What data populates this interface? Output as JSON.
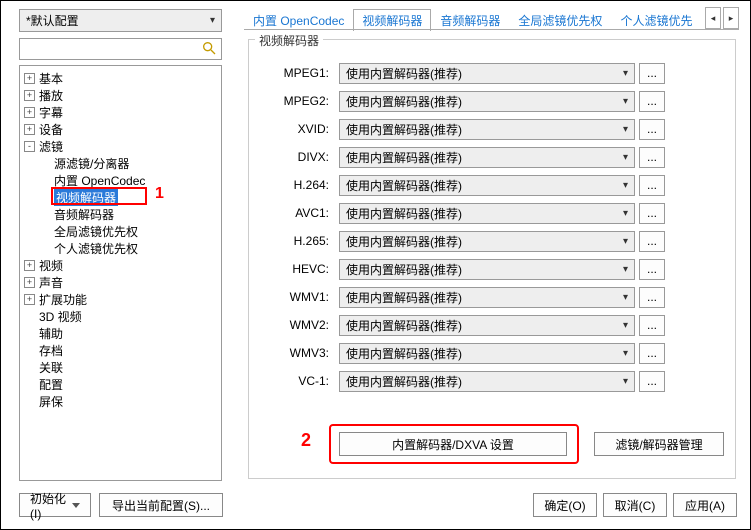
{
  "profile": {
    "selected": "*默认配置"
  },
  "search": {
    "placeholder": ""
  },
  "tree": {
    "items": [
      {
        "label": "基本",
        "lvl": 0,
        "exp": "+"
      },
      {
        "label": "播放",
        "lvl": 0,
        "exp": "+"
      },
      {
        "label": "字幕",
        "lvl": 0,
        "exp": "+"
      },
      {
        "label": "设备",
        "lvl": 0,
        "exp": "+"
      },
      {
        "label": "滤镜",
        "lvl": 0,
        "exp": "-"
      },
      {
        "label": "源滤镜/分离器",
        "lvl": 1,
        "exp": ""
      },
      {
        "label": "内置 OpenCodec",
        "lvl": 1,
        "exp": ""
      },
      {
        "label": "视频解码器",
        "lvl": 1,
        "exp": "",
        "selected": true
      },
      {
        "label": "音频解码器",
        "lvl": 1,
        "exp": ""
      },
      {
        "label": "全局滤镜优先权",
        "lvl": 1,
        "exp": ""
      },
      {
        "label": "个人滤镜优先权",
        "lvl": 1,
        "exp": ""
      },
      {
        "label": "视频",
        "lvl": 0,
        "exp": "+"
      },
      {
        "label": "声音",
        "lvl": 0,
        "exp": "+"
      },
      {
        "label": "扩展功能",
        "lvl": 0,
        "exp": "+"
      },
      {
        "label": "3D 视频",
        "lvl": 0,
        "exp": ""
      },
      {
        "label": "辅助",
        "lvl": 0,
        "exp": ""
      },
      {
        "label": "存档",
        "lvl": 0,
        "exp": ""
      },
      {
        "label": "关联",
        "lvl": 0,
        "exp": ""
      },
      {
        "label": "配置",
        "lvl": 0,
        "exp": ""
      },
      {
        "label": "屏保",
        "lvl": 0,
        "exp": ""
      }
    ]
  },
  "tabs": {
    "items": [
      "内置 OpenCodec",
      "视频解码器",
      "音频解码器",
      "全局滤镜优先权",
      "个人滤镜优先"
    ],
    "active_index": 1
  },
  "group_title": "视频解码器",
  "codecs": [
    {
      "label": "MPEG1:",
      "value": "使用内置解码器(推荐)"
    },
    {
      "label": "MPEG2:",
      "value": "使用内置解码器(推荐)"
    },
    {
      "label": "XVID:",
      "value": "使用内置解码器(推荐)"
    },
    {
      "label": "DIVX:",
      "value": "使用内置解码器(推荐)"
    },
    {
      "label": "H.264:",
      "value": "使用内置解码器(推荐)"
    },
    {
      "label": "AVC1:",
      "value": "使用内置解码器(推荐)"
    },
    {
      "label": "H.265:",
      "value": "使用内置解码器(推荐)"
    },
    {
      "label": "HEVC:",
      "value": "使用内置解码器(推荐)"
    },
    {
      "label": "WMV1:",
      "value": "使用内置解码器(推荐)"
    },
    {
      "label": "WMV2:",
      "value": "使用内置解码器(推荐)"
    },
    {
      "label": "WMV3:",
      "value": "使用内置解码器(推荐)"
    },
    {
      "label": "VC-1:",
      "value": "使用内置解码器(推荐)"
    }
  ],
  "buttons": {
    "dxva": "内置解码器/DXVA 设置",
    "filter_mgr": "滤镜/解码器管理",
    "init": "初始化(I)",
    "export": "导出当前配置(S)...",
    "ok": "确定(O)",
    "cancel": "取消(C)",
    "apply": "应用(A)"
  },
  "annotations": {
    "one": "1",
    "two": "2"
  },
  "ellipsis": "..."
}
